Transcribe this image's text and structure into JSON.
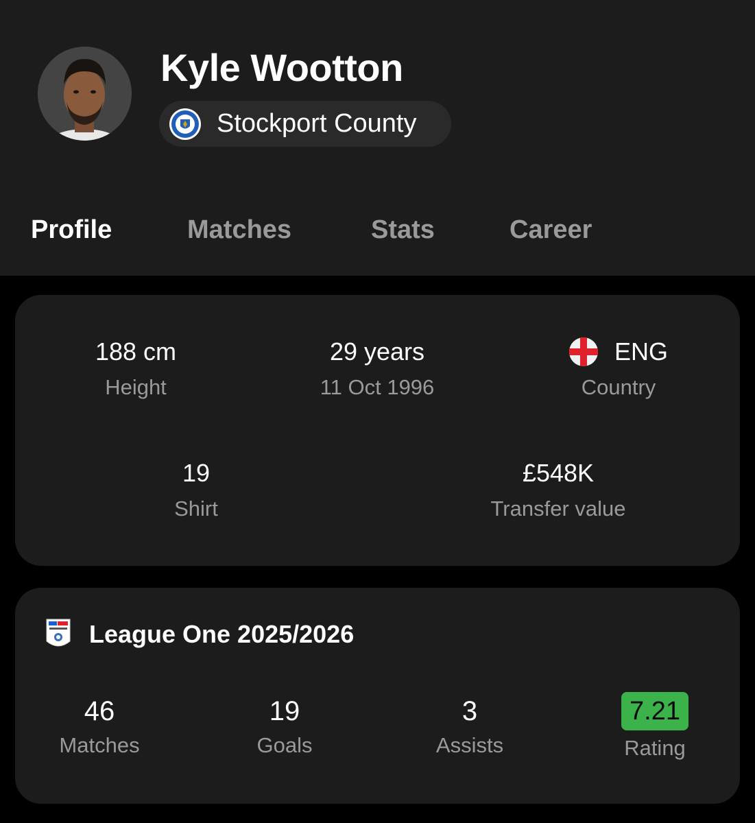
{
  "player": {
    "name": "Kyle Wootton",
    "team": "Stockport County"
  },
  "tabs": [
    {
      "label": "Profile",
      "active": true
    },
    {
      "label": "Matches",
      "active": false
    },
    {
      "label": "Stats",
      "active": false
    },
    {
      "label": "Career",
      "active": false
    }
  ],
  "info": {
    "height": {
      "value": "188 cm",
      "label": "Height"
    },
    "age": {
      "value": "29 years",
      "label": "11 Oct 1996"
    },
    "country": {
      "value": "ENG",
      "label": "Country"
    },
    "shirt": {
      "value": "19",
      "label": "Shirt"
    },
    "transfer": {
      "value": "£548K",
      "label": "Transfer value"
    }
  },
  "league": {
    "title": "League One 2025/2026",
    "stats": {
      "matches": {
        "value": "46",
        "label": "Matches"
      },
      "goals": {
        "value": "19",
        "label": "Goals"
      },
      "assists": {
        "value": "3",
        "label": "Assists"
      },
      "rating": {
        "value": "7.21",
        "label": "Rating"
      }
    }
  },
  "icons": {
    "avatar": "player-photo",
    "team_crest": "stockport-county-crest-icon",
    "flag": "england-flag-icon",
    "league_logo": "efl-league-one-logo-icon"
  },
  "colors": {
    "background": "#000000",
    "card": "#1c1c1c",
    "chip": "#2a2a2a",
    "muted_text": "#9a9a9a",
    "rating_green": "#3bb34a",
    "flag_red": "#e0202a"
  }
}
